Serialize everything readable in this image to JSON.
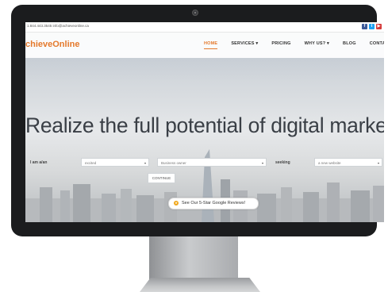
{
  "site": {
    "contact": "1.844.443.3545  info@achieveonline.ca",
    "logo_part1": "chieve",
    "logo_part2": "Online",
    "social_icons": [
      "facebook-icon",
      "twitter-icon",
      "youtube-icon"
    ]
  },
  "nav": {
    "items": [
      {
        "label": "HOME",
        "active": true
      },
      {
        "label": "SERVICES ▾"
      },
      {
        "label": "PRICING"
      },
      {
        "label": "WHY US? ▾"
      },
      {
        "label": "BLOG"
      },
      {
        "label": "CONTA"
      }
    ]
  },
  "hero": {
    "headline": "Realize the full potential of digital marketin"
  },
  "form": {
    "iam_label": "I am a/an",
    "adjective_value": "excited",
    "role_value": "Business owner",
    "seeking_label": "seeking",
    "goal_value": "a new website",
    "caret": "▾",
    "continue_label": "CONTINUE"
  },
  "reviews": {
    "label": "See Our 5-Star Google Reviews!",
    "star": "★"
  },
  "colors": {
    "accent": "#e4792c",
    "bezel": "#1b1c1e",
    "facebook": "#3b5998",
    "twitter": "#1da1f2",
    "youtube": "#d53b3b"
  }
}
